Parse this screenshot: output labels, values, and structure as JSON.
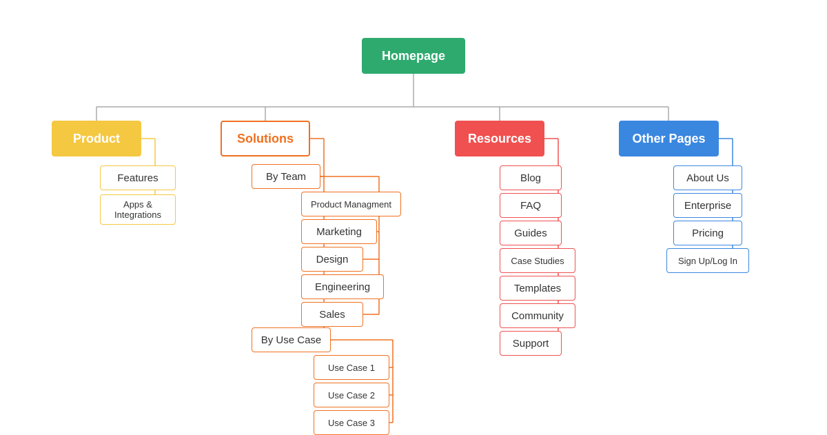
{
  "nodes": {
    "homepage": "Homepage",
    "product": "Product",
    "features": "Features",
    "apps": "Apps & Integrations",
    "solutions": "Solutions",
    "byteam": "By Team",
    "prodmgmt": "Product Managment",
    "marketing": "Marketing",
    "design": "Design",
    "engineering": "Engineering",
    "sales": "Sales",
    "byusecase": "By Use Case",
    "usecase1": "Use Case 1",
    "usecase2": "Use Case 2",
    "usecase3": "Use Case 3",
    "resources": "Resources",
    "blog": "Blog",
    "faq": "FAQ",
    "guides": "Guides",
    "casestudies": "Case Studies",
    "templates": "Templates",
    "community": "Community",
    "support": "Support",
    "otherpages": "Other Pages",
    "aboutus": "About Us",
    "enterprise": "Enterprise",
    "pricing": "Pricing",
    "signup": "Sign Up/Log In"
  },
  "colors": {
    "homepage": "#2eaa6e",
    "product": "#f5c842",
    "solutions": "#f07020",
    "resources": "#f05050",
    "otherpages": "#3a87e0",
    "connector": "#aaa"
  }
}
